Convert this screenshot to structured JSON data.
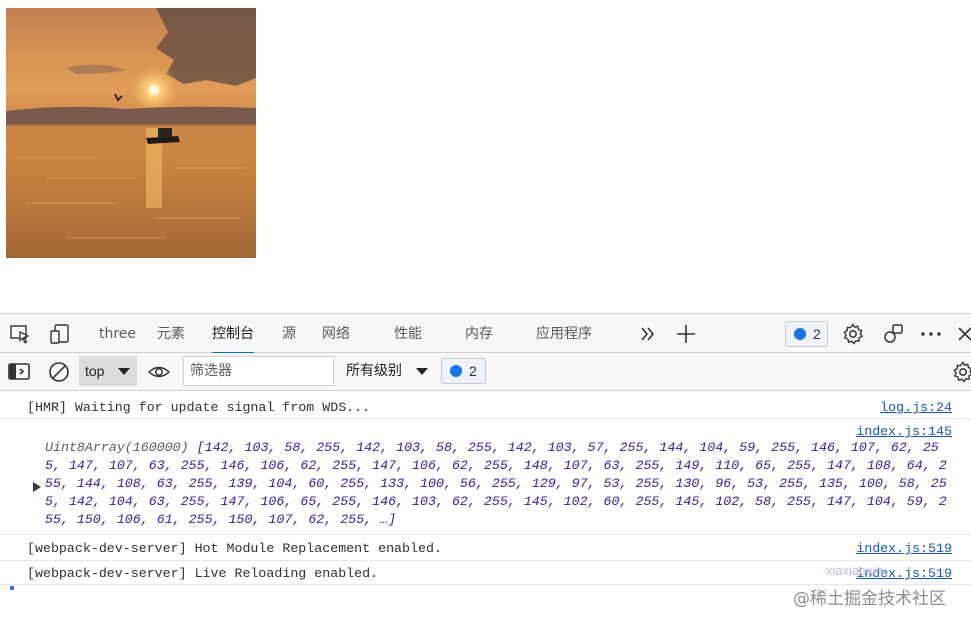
{
  "page": {
    "image_alt": "sunset-boat-image"
  },
  "devtools": {
    "tabs": [
      {
        "label": "three",
        "active": false
      },
      {
        "label": "元素",
        "active": false
      },
      {
        "label": "控制台",
        "active": true
      },
      {
        "label": "源",
        "active": false
      },
      {
        "label": "网络",
        "active": false
      },
      {
        "label": "性能",
        "active": false
      },
      {
        "label": "内存",
        "active": false
      },
      {
        "label": "应用程序",
        "active": false
      }
    ],
    "issues_count": "2",
    "icons": [
      "inspect-element-icon",
      "device-emulation-icon",
      "more-tabs-icon",
      "add-tab-icon",
      "settings-icon",
      "customize-icon",
      "more-options-icon",
      "close-icon"
    ],
    "accent_color": "#0f6cbd"
  },
  "console_toolbar": {
    "context": "top",
    "filter_placeholder": "筛选器",
    "levels_label": "所有级别",
    "issues_count": "2",
    "icons": [
      "toggle-sidebar-icon",
      "clear-console-icon",
      "live-expression-eye-icon",
      "console-settings-icon"
    ]
  },
  "console": {
    "messages": [
      {
        "text": "[HMR] Waiting for update signal from WDS...",
        "source": "log.js:24"
      },
      {
        "source": "index.js:145",
        "prefix": "Uint8Array(160000) ",
        "array_text": "[142, 103, 58, 255, 142, 103, 58, 255, 142, 103, 57, 255, 144, 104, 59, 255, 146, 107, 62, 255, 147, 107, 63, 255, 146, 106, 62, 255, 147, 106, 62, 255, 148, 107, 63, 255, 149, 110, 65, 255, 147, 108, 64, 255, 144, 108, 63, 255, 139, 104, 60, 255, 133, 100, 56, 255, 129, 97, 53, 255, 130, 96, 53, 255, 135, 100, 58, 255, 142, 104, 63, 255, 147, 106, 65, 255, 146, 103, 62, 255, 145, 102, 60, 255, 145, 102, 58, 255, 147, 104, 59, 255, 150, 106, 61, 255, 150, 107, 62, 255, …]"
      },
      {
        "text": "[webpack-dev-server] Hot Module Replacement enabled.",
        "source": "index.js:519"
      },
      {
        "text": "[webpack-dev-server] Live Reloading enabled.",
        "source": "index.js:519"
      }
    ]
  },
  "watermark": {
    "small": "xiaxiaoxia",
    "main": "@稀土掘金技术社区"
  }
}
